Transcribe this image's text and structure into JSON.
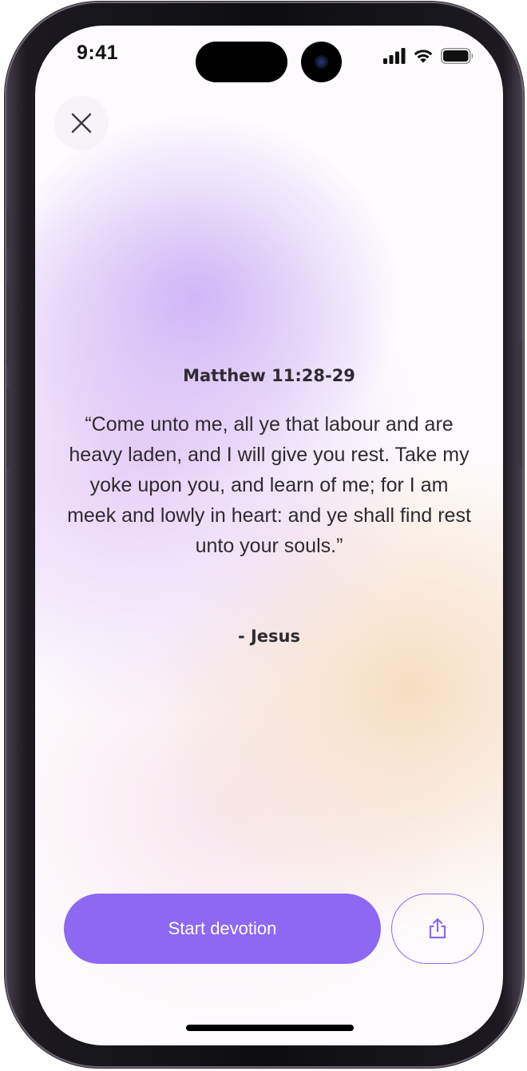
{
  "status_bar": {
    "time": "9:41",
    "icons": [
      "cellular-signal-icon",
      "wifi-icon",
      "battery-icon"
    ]
  },
  "close_button": {
    "icon": "close-icon"
  },
  "devotional": {
    "reference": "Matthew 11:28-29",
    "verse": "“Come unto me, all ye that labour and are heavy laden, and I will give you rest. Take my yoke upon you, and learn of me; for I am meek and lowly in heart: and ye shall find rest unto your souls.”",
    "attribution": "- Jesus"
  },
  "actions": {
    "start_label": "Start devotion",
    "share_icon": "share-icon"
  },
  "colors": {
    "accent": "#8d68f3",
    "text": "#2d2a30",
    "gradient_purple": "#cdb4f6",
    "gradient_peach": "#f6dcbe"
  }
}
